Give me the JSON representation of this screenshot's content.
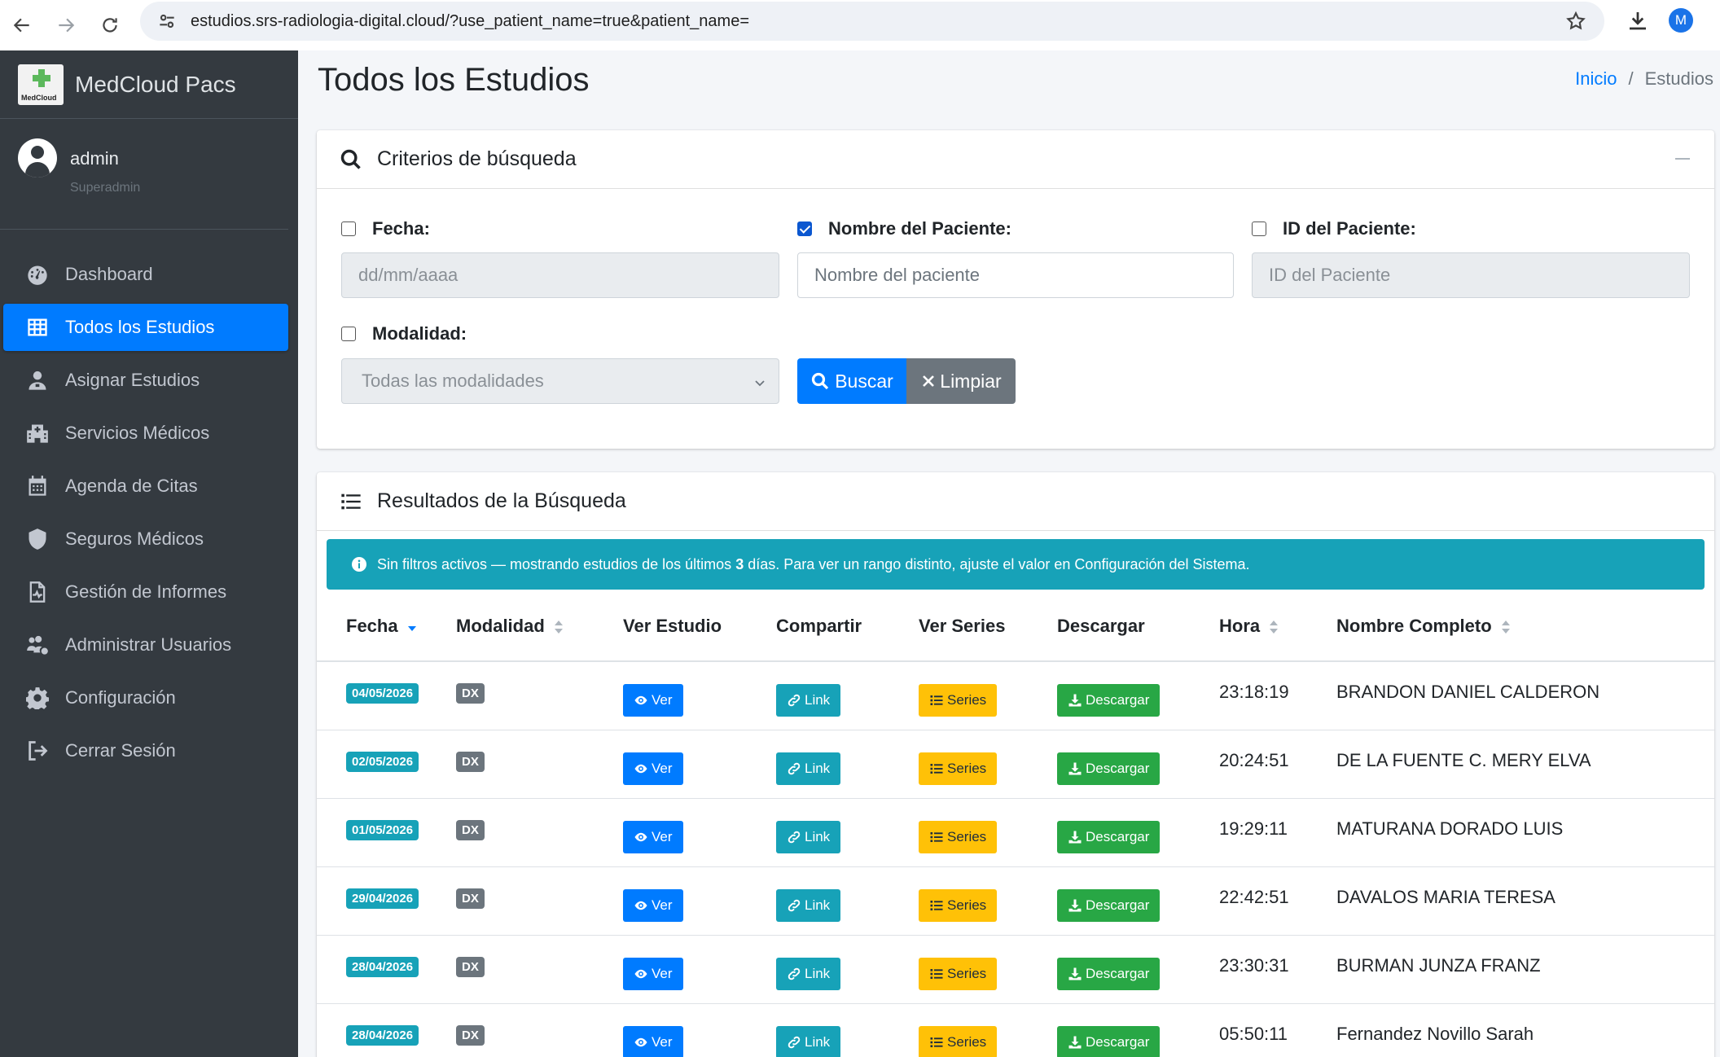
{
  "browser": {
    "url": "estudios.srs-radiologia-digital.cloud/?use_patient_name=true&patient_name=",
    "profile_initial": "M"
  },
  "sidebar": {
    "brand_name": "MedCloud Pacs",
    "brand_logo_text": "MedCloud",
    "user_name": "admin",
    "user_role": "Superadmin",
    "items": [
      {
        "label": "Dashboard",
        "icon": "tachometer-icon"
      },
      {
        "label": "Todos los Estudios",
        "icon": "grid-icon",
        "active": true
      },
      {
        "label": "Asignar Estudios",
        "icon": "user-doctor-icon"
      },
      {
        "label": "Servicios Médicos",
        "icon": "hospital-icon"
      },
      {
        "label": "Agenda de Citas",
        "icon": "calendar-icon"
      },
      {
        "label": "Seguros Médicos",
        "icon": "shield-icon"
      },
      {
        "label": "Gestión de Informes",
        "icon": "file-medical-icon"
      },
      {
        "label": "Administrar Usuarios",
        "icon": "users-cog-icon"
      },
      {
        "label": "Configuración",
        "icon": "gear-icon"
      },
      {
        "label": "Cerrar Sesión",
        "icon": "sign-out-icon"
      }
    ]
  },
  "header": {
    "title": "Todos los Estudios",
    "breadcrumb_home": "Inicio",
    "breadcrumb_sep": "/",
    "breadcrumb_current": "Estudios"
  },
  "search": {
    "title": "Criterios de búsqueda",
    "fecha_label": "Fecha:",
    "fecha_placeholder": "dd/mm/aaaa",
    "nombre_label": "Nombre del Paciente:",
    "nombre_placeholder": "Nombre del paciente",
    "id_label": "ID del Paciente:",
    "id_placeholder": "ID del Paciente",
    "modalidad_label": "Modalidad:",
    "modalidad_value": "Todas las modalidades",
    "buscar_label": "Buscar",
    "limpiar_label": "Limpiar"
  },
  "results": {
    "title": "Resultados de la Búsqueda",
    "alert_pre": "Sin filtros activos — mostrando estudios de los últimos",
    "alert_days": "3",
    "alert_post": "días. Para ver un rango distinto, ajuste el valor en Configuración del Sistema.",
    "columns": [
      "Fecha",
      "Modalidad",
      "Ver Estudio",
      "Compartir",
      "Ver Series",
      "Descargar",
      "Hora",
      "Nombre Completo"
    ],
    "button_labels": {
      "ver": "Ver",
      "link": "Link",
      "series": "Series",
      "descargar": "Descargar"
    },
    "rows": [
      {
        "fecha": "04/05/2026",
        "modalidad": "DX",
        "hora": "23:18:19",
        "nombre": "BRANDON DANIEL CALDERON"
      },
      {
        "fecha": "02/05/2026",
        "modalidad": "DX",
        "hora": "20:24:51",
        "nombre": "DE LA FUENTE C. MERY ELVA"
      },
      {
        "fecha": "01/05/2026",
        "modalidad": "DX",
        "hora": "19:29:11",
        "nombre": "MATURANA DORADO LUIS"
      },
      {
        "fecha": "29/04/2026",
        "modalidad": "DX",
        "hora": "22:42:51",
        "nombre": "DAVALOS MARIA TERESA"
      },
      {
        "fecha": "28/04/2026",
        "modalidad": "DX",
        "hora": "23:30:31",
        "nombre": "BURMAN JUNZA FRANZ"
      },
      {
        "fecha": "28/04/2026",
        "modalidad": "DX",
        "hora": "05:50:11",
        "nombre": "Fernandez Novillo Sarah"
      }
    ]
  },
  "colors": {
    "primary": "#007bff",
    "info": "#17a2b8",
    "warning": "#ffc107",
    "success": "#28a745",
    "secondary": "#6c757d",
    "sidebar": "#343a40"
  }
}
